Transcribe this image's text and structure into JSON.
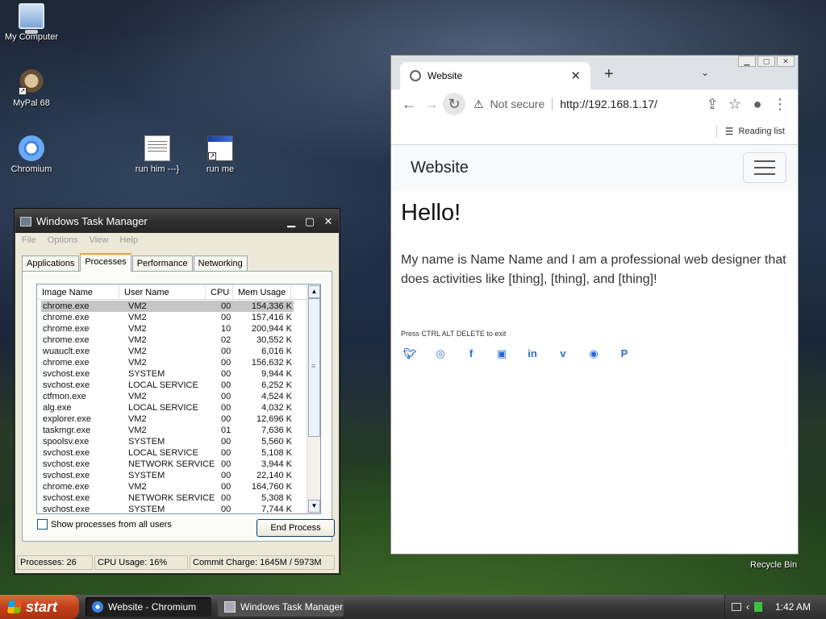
{
  "desktop": {
    "icons": [
      {
        "label": "My Computer"
      },
      {
        "label": "MyPal 68"
      },
      {
        "label": "Chromium"
      },
      {
        "label": "run him ---}"
      },
      {
        "label": "run me"
      },
      {
        "label": "Recycle Bin"
      }
    ]
  },
  "task_manager": {
    "title": "Windows Task Manager",
    "menu": [
      "File",
      "Options",
      "View",
      "Help"
    ],
    "tabs": [
      "Applications",
      "Processes",
      "Performance",
      "Networking"
    ],
    "active_tab": "Processes",
    "columns": [
      "Image Name",
      "User Name",
      "CPU",
      "Mem Usage"
    ],
    "rows": [
      [
        "chrome.exe",
        "VM2",
        "00",
        "154,336 K"
      ],
      [
        "chrome.exe",
        "VM2",
        "00",
        "157,416 K"
      ],
      [
        "chrome.exe",
        "VM2",
        "10",
        "200,944 K"
      ],
      [
        "chrome.exe",
        "VM2",
        "02",
        "30,552 K"
      ],
      [
        "wuauclt.exe",
        "VM2",
        "00",
        "6,016 K"
      ],
      [
        "chrome.exe",
        "VM2",
        "00",
        "156,632 K"
      ],
      [
        "svchost.exe",
        "SYSTEM",
        "00",
        "9,944 K"
      ],
      [
        "svchost.exe",
        "LOCAL SERVICE",
        "00",
        "6,252 K"
      ],
      [
        "ctfmon.exe",
        "VM2",
        "00",
        "4,524 K"
      ],
      [
        "alg.exe",
        "LOCAL SERVICE",
        "00",
        "4,032 K"
      ],
      [
        "explorer.exe",
        "VM2",
        "00",
        "12,696 K"
      ],
      [
        "taskmgr.exe",
        "VM2",
        "01",
        "7,636 K"
      ],
      [
        "spoolsv.exe",
        "SYSTEM",
        "00",
        "5,560 K"
      ],
      [
        "svchost.exe",
        "LOCAL SERVICE",
        "00",
        "5,108 K"
      ],
      [
        "svchost.exe",
        "NETWORK SERVICE",
        "00",
        "3,944 K"
      ],
      [
        "svchost.exe",
        "SYSTEM",
        "00",
        "22,140 K"
      ],
      [
        "chrome.exe",
        "VM2",
        "00",
        "164,760 K"
      ],
      [
        "svchost.exe",
        "NETWORK SERVICE",
        "00",
        "5,308 K"
      ],
      [
        "svchost.exe",
        "SYSTEM",
        "00",
        "7,744 K"
      ]
    ],
    "show_all_label": "Show processes from all users",
    "end_process_label": "End Process",
    "status": {
      "processes": "Processes: 26",
      "cpu": "CPU Usage: 16%",
      "commit": "Commit Charge: 1645M / 5973M"
    }
  },
  "browser": {
    "tab_title": "Website",
    "security": "Not secure",
    "url": "http://192.168.1.17/",
    "reading_list": "Reading list",
    "page": {
      "brand": "Website",
      "heading": "Hello!",
      "intro": "My name is Name Name and I am a professional web designer that does activities like [thing], [thing], and [thing]!",
      "note": "Press CTRL ALT DELETE to exit",
      "socials": [
        "twitter-icon",
        "dribbble-icon",
        "facebook-icon",
        "youtube-icon",
        "linkedin-icon",
        "vimeo-icon",
        "github-icon",
        "paypal-icon"
      ]
    }
  },
  "taskbar": {
    "start_label": "start",
    "tasks": [
      "Website - Chromium",
      "Windows Task Manager"
    ],
    "clock": "1:42 AM"
  }
}
